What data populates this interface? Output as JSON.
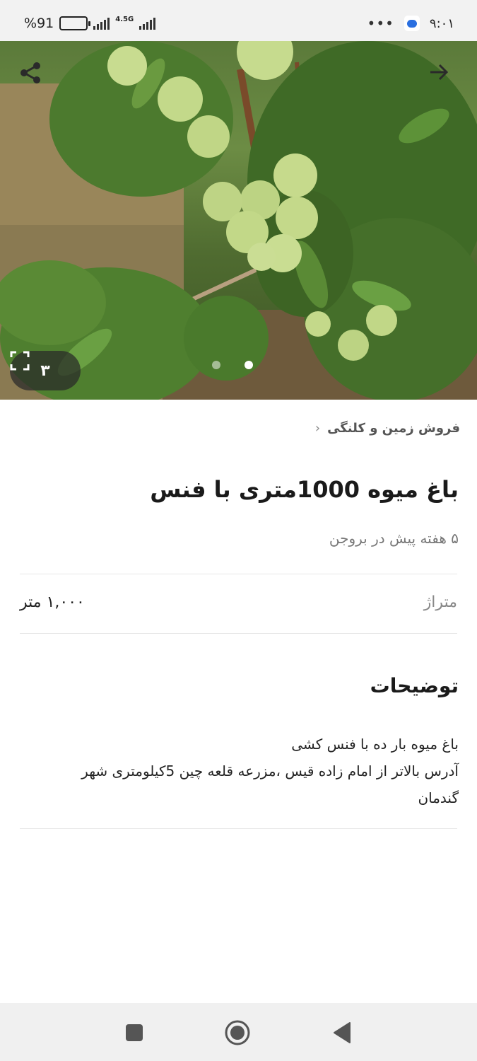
{
  "status_bar": {
    "battery_percent": "91",
    "percent_sign": "%",
    "network": "4.5G",
    "dots": "•••",
    "time": "۹:۰۱"
  },
  "hero": {
    "image_counter": "۳",
    "slide_count": 3,
    "active_slide": 2,
    "icons": {
      "share": "share-icon",
      "back": "arrow-right-icon",
      "fullscreen": "fullscreen-icon"
    }
  },
  "breadcrumb": {
    "label": "فروش زمین و کلنگی",
    "chevron": "‹"
  },
  "listing": {
    "title": "باغ میوه 1000متری با فنس",
    "posted": "۵ هفته پیش در بروجن",
    "specs": [
      {
        "label": "متراژ",
        "value": "۱,۰۰۰ متر"
      }
    ]
  },
  "description": {
    "heading": "توضیحات",
    "lines": [
      "باغ میوه بار ده با فنس کشی",
      "آدرس بالاتر از امام زاده قیس ،مزرعه قلعه چین 5کیلومتری شهر",
      "گندمان"
    ]
  },
  "nav_bar": {
    "recents": "square-icon",
    "home": "circle-icon",
    "back": "triangle-back-icon"
  },
  "colors": {
    "status_bar_bg": "#f2f2f2",
    "nav_bar_bg": "#f0f0f0",
    "divider": "#e6e6e6"
  }
}
